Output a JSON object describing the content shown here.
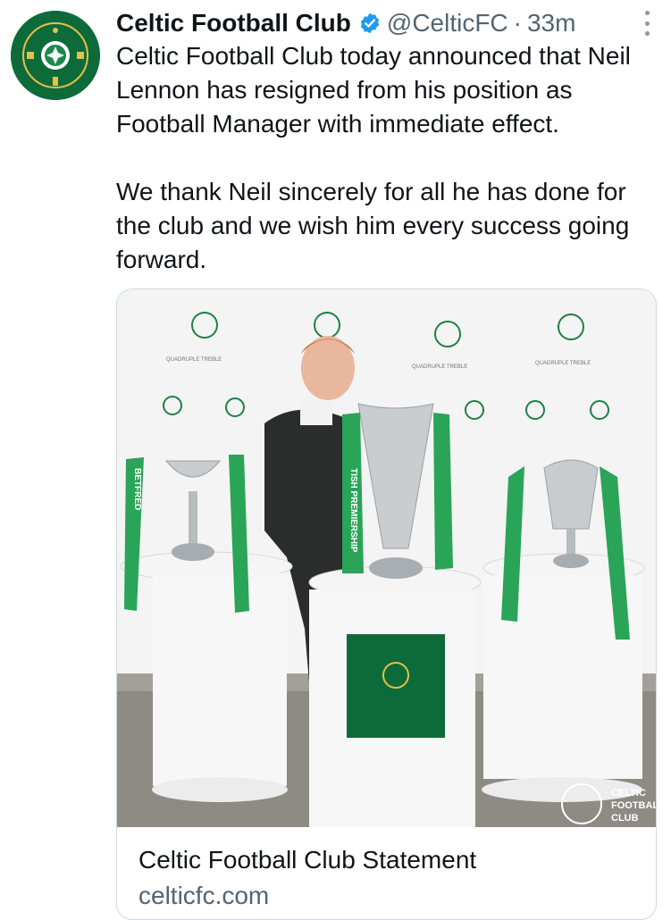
{
  "tweet": {
    "author_name": "Celtic Football Club",
    "handle": "@CelticFC",
    "separator": "·",
    "time": "33m",
    "paragraphs": [
      "Celtic Football Club today announced that Neil Lennon has resigned from his position as Football Manager with immediate effect.",
      "We thank Neil sincerely for all he has done for the club and we wish him every success going forward."
    ]
  },
  "icons": {
    "avatar": "celtic-crest-icon",
    "verified": "verified-badge-icon",
    "more": "more-options-icon"
  },
  "card": {
    "title": "Celtic Football Club Statement",
    "domain": "celticfc.com",
    "image": {
      "ribbon_text_left": "BETFRED",
      "ribbon_text_center": "TISH PREMIERSHIP",
      "backdrop_text": "QUADRUPLE TREBLE",
      "watermark": [
        "CELTIC",
        "FOOTBALL",
        "CLUB"
      ]
    }
  },
  "colors": {
    "celtic_green": "#0d6b3a",
    "verified_blue": "#1d9bf0",
    "text": "#0f1419",
    "secondary": "#536471"
  }
}
